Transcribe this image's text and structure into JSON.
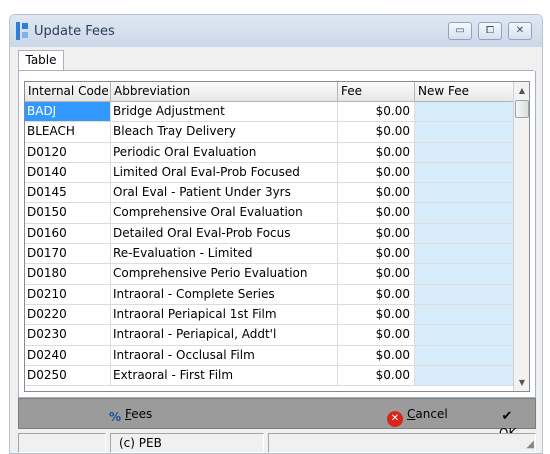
{
  "window": {
    "title": "Update Fees",
    "controls": {
      "minimize": "▭",
      "maximize": "⧠",
      "close": "✕"
    }
  },
  "tabs": [
    {
      "label": "Table"
    }
  ],
  "grid": {
    "columns": [
      "Internal Code",
      "Abbreviation",
      "Fee",
      "New Fee"
    ],
    "rows": [
      {
        "code": "BADJ",
        "abbr": "Bridge Adjustment",
        "fee": "$0.00",
        "new_fee": ""
      },
      {
        "code": "BLEACH",
        "abbr": "Bleach Tray Delivery",
        "fee": "$0.00",
        "new_fee": ""
      },
      {
        "code": "D0120",
        "abbr": "Periodic Oral Evaluation",
        "fee": "$0.00",
        "new_fee": ""
      },
      {
        "code": "D0140",
        "abbr": "Limited Oral Eval-Prob Focused",
        "fee": "$0.00",
        "new_fee": ""
      },
      {
        "code": "D0145",
        "abbr": "Oral Eval - Patient Under 3yrs",
        "fee": "$0.00",
        "new_fee": ""
      },
      {
        "code": "D0150",
        "abbr": "Comprehensive Oral Evaluation",
        "fee": "$0.00",
        "new_fee": ""
      },
      {
        "code": "D0160",
        "abbr": "Detailed Oral Eval-Prob Focus",
        "fee": "$0.00",
        "new_fee": ""
      },
      {
        "code": "D0170",
        "abbr": "Re-Evaluation - Limited",
        "fee": "$0.00",
        "new_fee": ""
      },
      {
        "code": "D0180",
        "abbr": "Comprehensive Perio Evaluation",
        "fee": "$0.00",
        "new_fee": ""
      },
      {
        "code": "D0210",
        "abbr": "Intraoral - Complete Series",
        "fee": "$0.00",
        "new_fee": ""
      },
      {
        "code": "D0220",
        "abbr": "Intraoral Periapical 1st Film",
        "fee": "$0.00",
        "new_fee": ""
      },
      {
        "code": "D0230",
        "abbr": "Intraoral - Periapical, Addt'l",
        "fee": "$0.00",
        "new_fee": ""
      },
      {
        "code": "D0240",
        "abbr": "Intraoral - Occlusal Film",
        "fee": "$0.00",
        "new_fee": ""
      },
      {
        "code": "D0250",
        "abbr": "Extraoral - First Film",
        "fee": "$0.00",
        "new_fee": ""
      }
    ],
    "selected_row": 0,
    "scroll": {
      "up": "▲",
      "down": "▼"
    }
  },
  "buttons": {
    "fees_accel": "F",
    "fees_rest": "ees",
    "cancel_accel": "C",
    "cancel_rest": "ancel",
    "ok_accel": "O",
    "ok_rest": "K"
  },
  "icons": {
    "fees": "%",
    "cancel": "✕",
    "ok": "✔"
  },
  "status": {
    "left": "",
    "middle": "(c) PEB",
    "right": ""
  },
  "colors": {
    "selection": "#3399ff",
    "new_fee_bg": "#d6ecfa",
    "button_bar": "#9b9b9b"
  }
}
